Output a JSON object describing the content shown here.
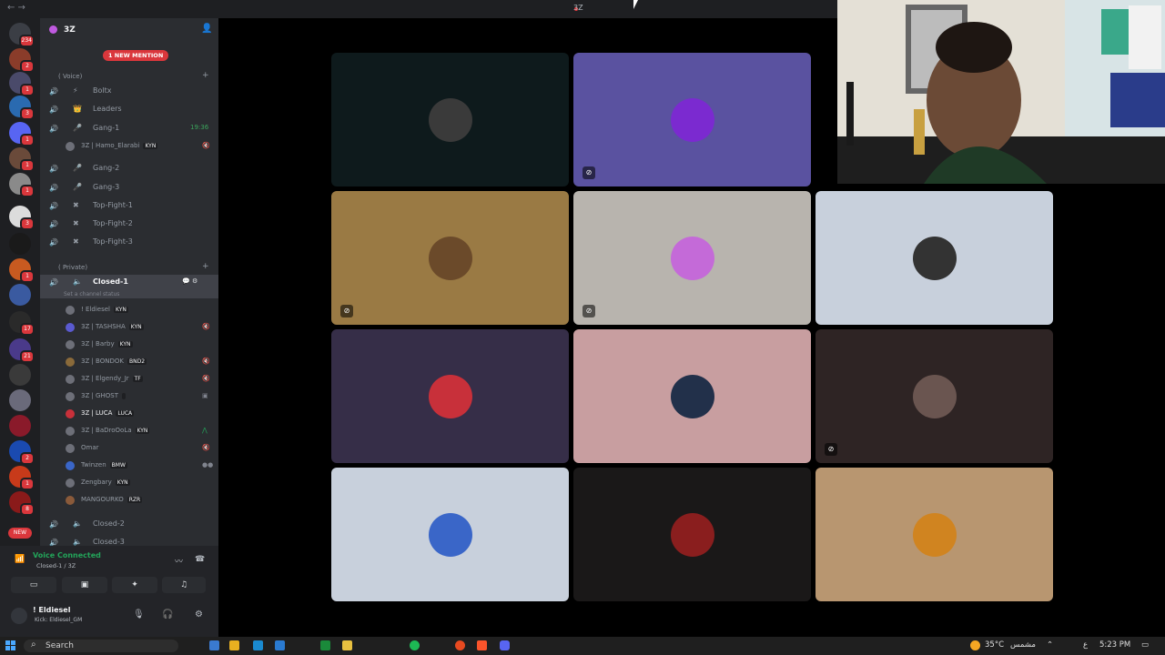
{
  "window": {
    "title": "3Z"
  },
  "guilds": {
    "badges": [
      "234",
      "2",
      "1",
      "3",
      "1",
      "1",
      "1",
      "3",
      "1",
      "1",
      "1",
      "1",
      "1",
      "1",
      "17",
      "21",
      "1",
      "1",
      "1",
      "1",
      "2",
      "1",
      "1",
      "8"
    ],
    "new_label": "NEW"
  },
  "server": {
    "name": "3Z",
    "mention_label": "1 NEW MENTION"
  },
  "categories": {
    "voice": "( Voice)",
    "private": "( Private)"
  },
  "channels": [
    {
      "name": "Boltx"
    },
    {
      "name": "Leaders"
    },
    {
      "name": "Gang-1",
      "time": "19:36"
    },
    {
      "name": "Gang-2"
    },
    {
      "name": "Gang-3"
    },
    {
      "name": "Top-Fight-1"
    },
    {
      "name": "Top-Fight-2"
    },
    {
      "name": "Top-Fight-3"
    },
    {
      "name": "Closed-1"
    },
    {
      "name": "Closed-2"
    },
    {
      "name": "Closed-3"
    }
  ],
  "gang1_member": {
    "name": "3Z | Hamo_Elarabi",
    "tag": "KYN"
  },
  "channel_status": "Set a channel status",
  "closed1_members": [
    {
      "name": "! Eldiesel",
      "tag": "KYN"
    },
    {
      "name": "3Z | TASHSHA",
      "tag": "KYN"
    },
    {
      "name": "3Z | Barby",
      "tag": "KYN"
    },
    {
      "name": "3Z | BONDOK",
      "tag": "BND2"
    },
    {
      "name": "3Z | Elgendy_Jr",
      "tag": "TF"
    },
    {
      "name": "3Z | GHOST",
      "tag": ""
    },
    {
      "name": "3Z | LUCA",
      "tag": "LUCA"
    },
    {
      "name": "3Z | BaDroOoLa",
      "tag": "KYN"
    },
    {
      "name": "Omar",
      "tag": ""
    },
    {
      "name": "Twinzen",
      "tag": "BMW"
    },
    {
      "name": "Zengbary",
      "tag": "KYN"
    },
    {
      "name": "MANGOURKO",
      "tag": "RZR"
    }
  ],
  "voice_panel": {
    "status": "Voice Connected",
    "channel": "Closed-1 / 3Z"
  },
  "user": {
    "name": "! Eldiesel",
    "status": "Kick: Eldiesel_GM"
  },
  "tiles": [
    {
      "bg": "#0e1a1c",
      "avatar": "#3a3a3a",
      "muted": false
    },
    {
      "bg": "#5a52a0",
      "avatar": "#7b2ad0",
      "muted": true
    },
    {
      "bg": "#9a7a44",
      "avatar": "#6b4a2a",
      "muted": true
    },
    {
      "bg": "#b8b4ae",
      "avatar": "#c46ad8",
      "muted": true
    },
    {
      "bg": "#c8d0dc",
      "avatar": "#333333",
      "muted": false
    },
    {
      "bg": "#362e48",
      "avatar": "#c8303a",
      "muted": false
    },
    {
      "bg": "#c89ea0",
      "avatar": "#22304a",
      "muted": false
    },
    {
      "bg": "#2e2424",
      "avatar": "#6a5550",
      "muted": true
    },
    {
      "bg": "#c8d0dc",
      "avatar": "#3a66c8",
      "muted": false
    },
    {
      "bg": "#1a1818",
      "avatar": "#8a1e1e",
      "muted": false
    },
    {
      "bg": "#b89670",
      "avatar": "#d08420",
      "muted": false
    }
  ],
  "taskbar": {
    "search": "Search",
    "temp": "35°C",
    "weather": "مشمس",
    "lang": "ع",
    "time": "5:23 PM"
  }
}
